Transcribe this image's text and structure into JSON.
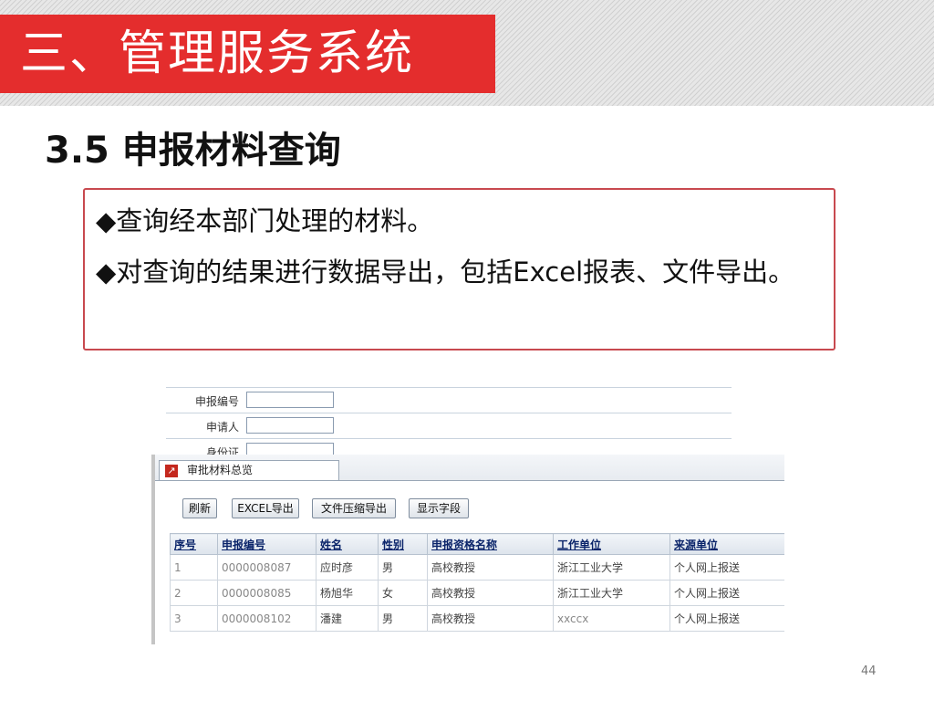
{
  "slide": {
    "title": "三、管理服务系统",
    "subtitle": "3.5 申报材料查询",
    "bullets": [
      "◆查询经本部门处理的材料。",
      "◆对查询的结果进行数据导出，包括Excel报表、文件导出。"
    ],
    "page_number": "44"
  },
  "form": {
    "fields": [
      {
        "label": "申报编号"
      },
      {
        "label": "申请人"
      },
      {
        "label": "身份证"
      }
    ]
  },
  "panel": {
    "tab_label": "审批材料总览",
    "tab_icon": "arrow-icon",
    "buttons": [
      "刷新",
      "EXCEL导出",
      "文件压缩导出",
      "显示字段"
    ],
    "table": {
      "headers": [
        "序号",
        "申报编号",
        "姓名",
        "性别",
        "申报资格名称",
        "工作单位",
        "来源单位"
      ],
      "rows": [
        [
          "1",
          "0000008087",
          "应时彦",
          "男",
          "高校教授",
          "浙江工业大学",
          "个人网上报送"
        ],
        [
          "2",
          "0000008085",
          "杨旭华",
          "女",
          "高校教授",
          "浙江工业大学",
          "个人网上报送"
        ],
        [
          "3",
          "0000008102",
          "潘建",
          "男",
          "高校教授",
          "xxccx",
          "个人网上报送"
        ]
      ]
    }
  },
  "colors": {
    "title_bg": "#e42d2d",
    "box_border": "#c8494f",
    "tab_icon": "#c4281e"
  }
}
